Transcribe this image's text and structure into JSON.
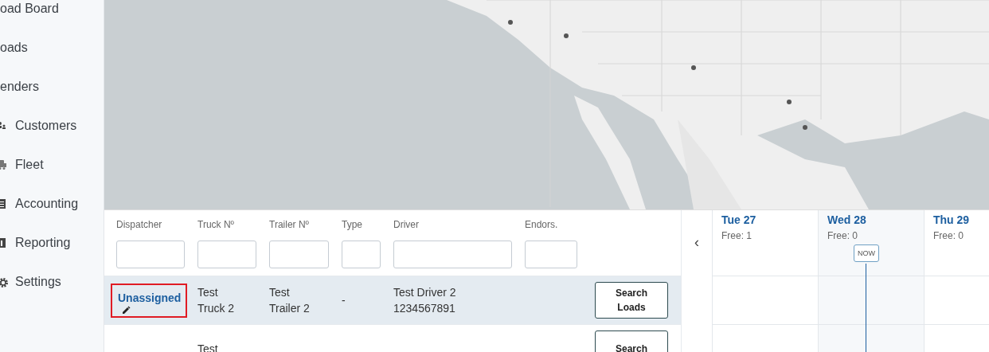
{
  "sidebar": {
    "items": [
      {
        "label": "oad Board",
        "kind": "clipped"
      },
      {
        "label": "oads",
        "kind": "clipped"
      },
      {
        "label": "enders",
        "kind": "clipped"
      },
      {
        "label": "Customers",
        "kind": "people"
      },
      {
        "label": "Fleet",
        "kind": "truck"
      },
      {
        "label": "Accounting",
        "kind": "ledger"
      },
      {
        "label": "Reporting",
        "kind": "chart"
      },
      {
        "label": "Settings",
        "kind": "gear"
      }
    ]
  },
  "table": {
    "columns": [
      {
        "label": "Dispatcher"
      },
      {
        "label": "Truck Nº"
      },
      {
        "label": "Trailer Nº"
      },
      {
        "label": "Type"
      },
      {
        "label": "Driver"
      },
      {
        "label": "Endors."
      }
    ],
    "rows": [
      {
        "selected": true,
        "dispatcher": "Unassigned",
        "highlighted": true,
        "truck": [
          "Test",
          "Truck 2"
        ],
        "trailer": [
          "Test",
          "Trailer 2"
        ],
        "type": "-",
        "driver": [
          "Test Driver 2",
          "1234567891"
        ],
        "button": [
          "Search",
          "Loads"
        ]
      },
      {
        "selected": false,
        "truck": [
          "Test"
        ],
        "trailer": [],
        "driver": [],
        "button": [
          "Search"
        ]
      }
    ]
  },
  "timeline": {
    "prev": "‹",
    "now_label": "NOW",
    "days": [
      {
        "label": "Tue 27",
        "free": "Free: 1",
        "current": false
      },
      {
        "label": "Wed 28",
        "free": "Free: 0",
        "current": true
      },
      {
        "label": "Thu 29",
        "free": "Free: 0",
        "current": false
      }
    ]
  }
}
